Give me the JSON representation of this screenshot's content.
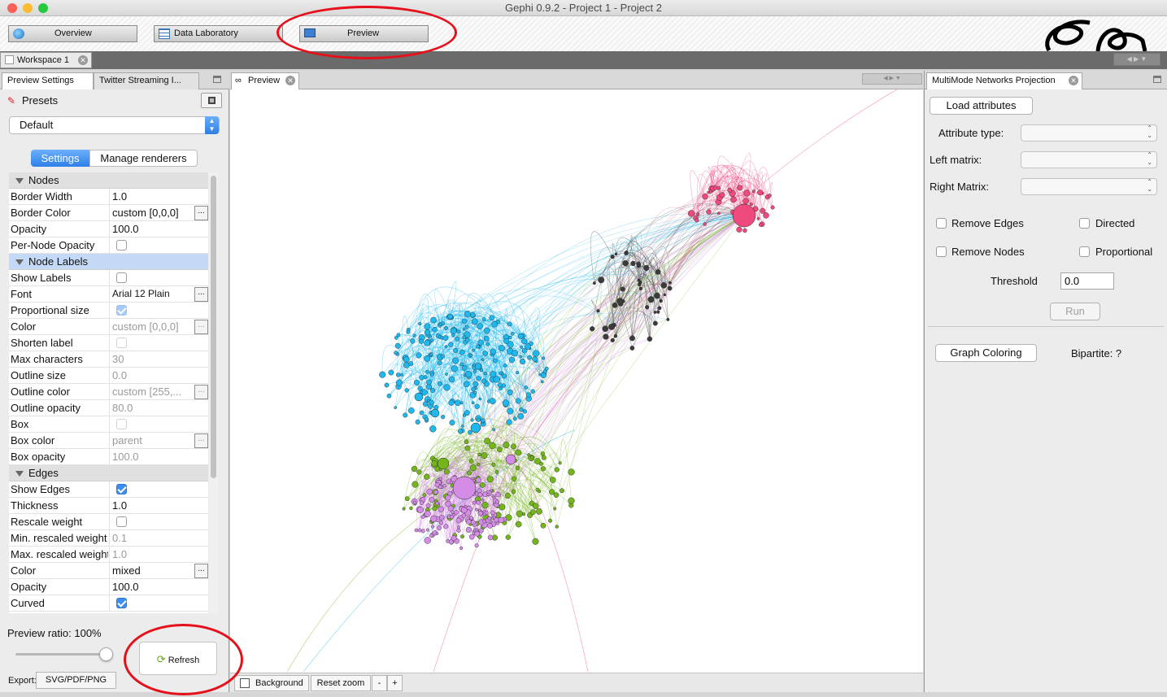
{
  "window": {
    "title": "Gephi 0.9.2 - Project 1 - Project 2"
  },
  "toolbar": {
    "overview": "Overview",
    "data_laboratory": "Data Laboratory",
    "preview": "Preview"
  },
  "workspace": {
    "tab": "Workspace 1"
  },
  "left_panel": {
    "tabs": [
      "Preview Settings",
      "Twitter Streaming I..."
    ],
    "presets_label": "Presets",
    "preset_value": "Default",
    "subtabs": [
      "Settings",
      "Manage renderers"
    ],
    "rows": [
      {
        "type": "section",
        "label": "Nodes"
      },
      {
        "label": "Border Width",
        "value": "1.0"
      },
      {
        "label": "Border Color",
        "value": "custom [0,0,0]",
        "dots": true
      },
      {
        "label": "Opacity",
        "value": "100.0"
      },
      {
        "label": "Per-Node Opacity",
        "check": false
      },
      {
        "type": "section",
        "label": "Node Labels",
        "selected": true
      },
      {
        "label": "Show Labels",
        "check": false
      },
      {
        "label": "Font",
        "value": "Arial 12 Plain",
        "dots": true,
        "small": true
      },
      {
        "label": "Proportional size",
        "check": true,
        "dim": true
      },
      {
        "label": "Color",
        "value": "custom [0,0,0]",
        "dots": true,
        "disabled": true
      },
      {
        "label": "Shorten label",
        "check": false,
        "dim": true
      },
      {
        "label": "Max characters",
        "value": "30",
        "disabled": true
      },
      {
        "label": "Outline size",
        "value": "0.0",
        "disabled": true
      },
      {
        "label": "Outline color",
        "value": "custom [255,...",
        "dots": true,
        "disabled": true
      },
      {
        "label": "Outline opacity",
        "value": "80.0",
        "disabled": true
      },
      {
        "label": "Box",
        "check": false,
        "dim": true
      },
      {
        "label": "Box color",
        "value": "parent",
        "dots": true,
        "disabled": true
      },
      {
        "label": "Box opacity",
        "value": "100.0",
        "disabled": true
      },
      {
        "type": "section",
        "label": "Edges"
      },
      {
        "label": "Show Edges",
        "check": true
      },
      {
        "label": "Thickness",
        "value": "1.0"
      },
      {
        "label": "Rescale weight",
        "check": false
      },
      {
        "label": "Min. rescaled weight",
        "value": "0.1",
        "disabled": true
      },
      {
        "label": "Max. rescaled weight",
        "value": "1.0",
        "disabled": true
      },
      {
        "label": "Color",
        "value": "mixed",
        "dots": true
      },
      {
        "label": "Opacity",
        "value": "100.0"
      },
      {
        "label": "Curved",
        "check": true
      }
    ],
    "preview_ratio": "Preview ratio: 100%",
    "preview_ratio_value": 1.0,
    "refresh": "Refresh",
    "export_label": "Export:",
    "export_button": "SVG/PDF/PNG"
  },
  "preview": {
    "tab": "Preview",
    "background_label": "Background",
    "reset_zoom": "Reset zoom",
    "zoom_out": "-",
    "zoom_in": "+",
    "cluster_colors": {
      "blue": "#1fb8ee",
      "green": "#74b51c",
      "purple": "#d48ce6",
      "pink": "#ee4a7e",
      "dark": "#3b3b3b"
    }
  },
  "right_panel": {
    "tab": "MultiMode Networks Projection",
    "load_attributes": "Load attributes",
    "attribute_type": "Attribute type:",
    "left_matrix": "Left matrix:",
    "right_matrix": "Right Matrix:",
    "remove_edges": "Remove Edges",
    "directed": "Directed",
    "remove_nodes": "Remove Nodes",
    "proportional": "Proportional",
    "threshold_label": "Threshold",
    "threshold_value": "0.0",
    "run": "Run",
    "graph_coloring": "Graph Coloring",
    "bipartite": "Bipartite: ?"
  }
}
